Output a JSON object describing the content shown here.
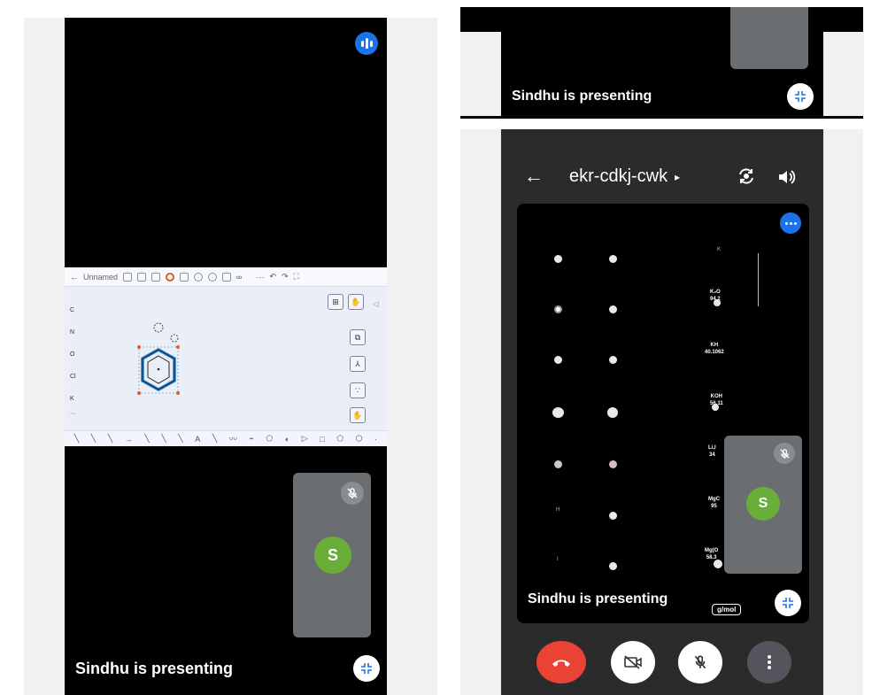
{
  "left": {
    "chem_toolbar": {
      "back_glyph": "←",
      "doc_title": "Unnamed",
      "more": "···"
    },
    "chem_elements": [
      "C",
      "N",
      "O",
      "Cl",
      "K",
      "···"
    ],
    "chem_bottom_tools": [
      "╲",
      "╲",
      "╲",
      "→",
      "╲",
      "╲",
      "╲",
      "A",
      "╲",
      "〰",
      "⌁",
      "⬠",
      "◐",
      "▷",
      "□",
      "⬠",
      "⬡",
      "·"
    ],
    "participant_initial": "S",
    "presenting_label": "Sindhu is presenting"
  },
  "right": {
    "top_presenting_label": "Sindhu is presenting",
    "meeting_code": "ekr-cdkj-cwk",
    "meeting_chevron": "▸",
    "back_glyph": "←",
    "participant_initial": "S",
    "presenting_label": "Sindhu is presenting",
    "unit_label": "g/mol",
    "chem_labels": [
      {
        "text": "K"
      },
      {
        "text": "K₂O\n94.2"
      },
      {
        "text": "KH\n40.1062"
      },
      {
        "text": "KOH\n56.11"
      },
      {
        "text": "Li,I\n34"
      },
      {
        "text": "MgC\n95"
      },
      {
        "text": "Mg(O\n58.3"
      }
    ],
    "left_col_letters": [
      "H",
      "I"
    ]
  },
  "colors": {
    "end_call": "#ea4335",
    "accent_blue": "#1a73e8",
    "avatar_green": "#6aae3a"
  },
  "icons": [
    "audio-levels-icon",
    "mic-off-icon",
    "exit-fullscreen-icon",
    "back-arrow-icon",
    "switch-camera-icon",
    "speaker-icon",
    "more-dots-icon",
    "end-call-icon",
    "camera-off-icon",
    "more-vert-icon"
  ]
}
